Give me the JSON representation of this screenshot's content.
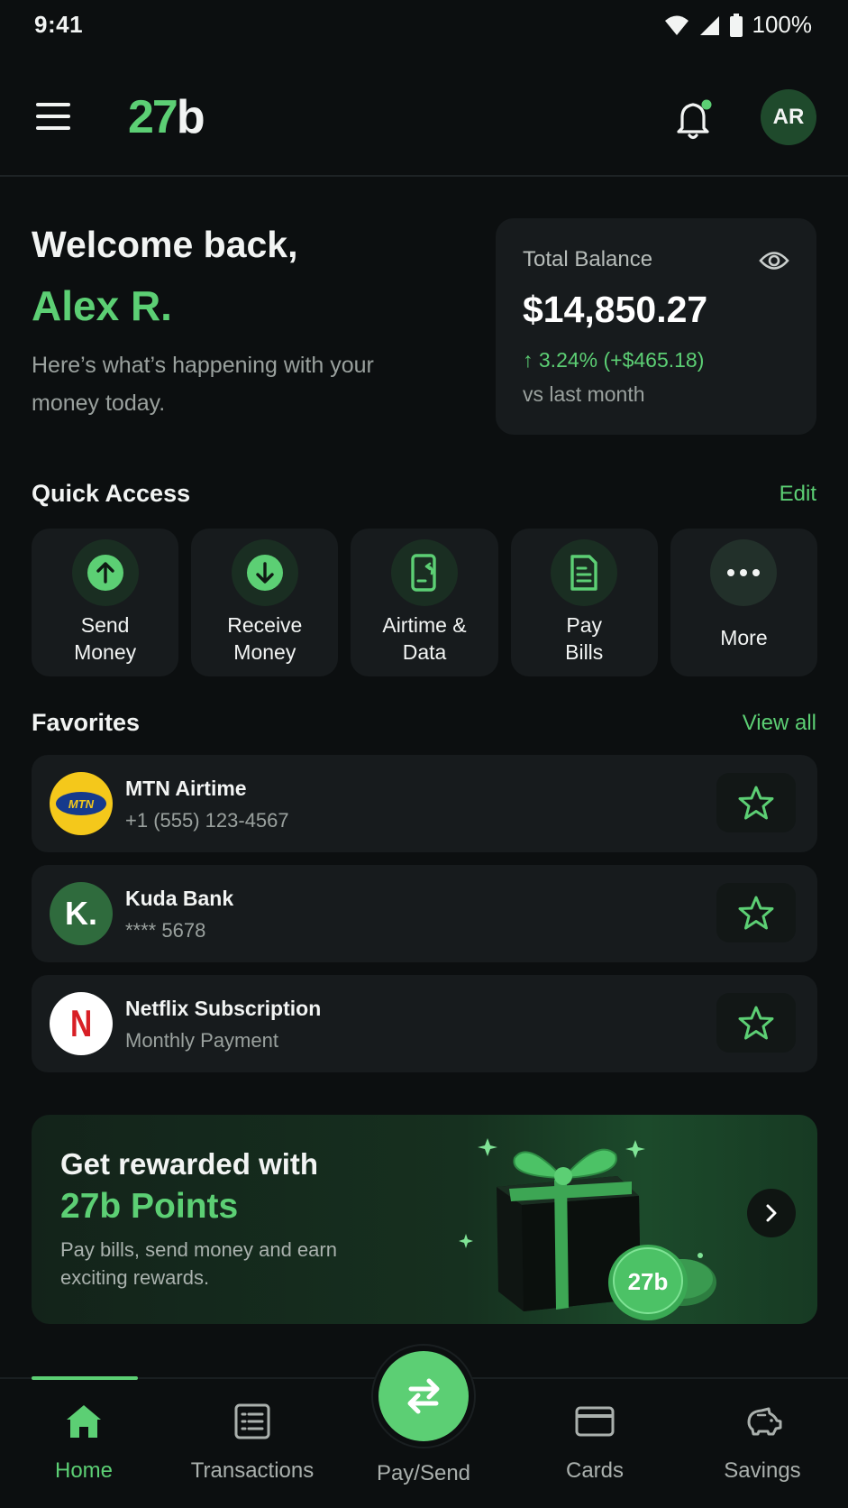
{
  "status_bar": {
    "time": "9:41",
    "battery": "100%"
  },
  "header": {
    "logo_main": "27",
    "logo_tail": "b",
    "avatar_initials": "AR"
  },
  "welcome": {
    "greeting": "Welcome back,",
    "name": "Alex R.",
    "subtitle": "Here’s what’s happening with your money today."
  },
  "balance": {
    "label": "Total Balance",
    "amount": "$14,850.27",
    "change": "↑ 3.24% (+$465.18)",
    "period": "vs last month"
  },
  "quick_access": {
    "title": "Quick Access",
    "edit_label": "Edit",
    "items": [
      {
        "label": "Send\nMoney",
        "icon": "arrow-up-icon"
      },
      {
        "label": "Receive\nMoney",
        "icon": "arrow-down-icon"
      },
      {
        "label": "Airtime &\nData",
        "icon": "phone-icon"
      },
      {
        "label": "Pay\nBills",
        "icon": "bill-icon"
      },
      {
        "label": "More",
        "icon": "more-icon"
      }
    ]
  },
  "favorites": {
    "title": "Favorites",
    "view_all_label": "View all",
    "items": [
      {
        "name": "MTN Airtime",
        "sub": "+1 (555) 123-4567",
        "logo_text": "MTN"
      },
      {
        "name": "Kuda Bank",
        "sub": "**** 5678",
        "logo_text": "K."
      },
      {
        "name": "Netflix Subscription",
        "sub": "Monthly Payment",
        "logo_text": "N"
      }
    ]
  },
  "promo": {
    "line1": "Get rewarded with",
    "line2": "27b Points",
    "subtitle": "Pay bills, send money and earn exciting rewards.",
    "coin_text": "27b"
  },
  "bottom_nav": {
    "items": [
      "Home",
      "Transactions",
      "Pay/Send",
      "Cards",
      "Savings"
    ]
  },
  "colors": {
    "accent": "#5ccf74",
    "background": "#0c0f10",
    "card": "#171b1d",
    "mtn_yellow": "#f4c81b",
    "netflix_red": "#d81f26"
  }
}
